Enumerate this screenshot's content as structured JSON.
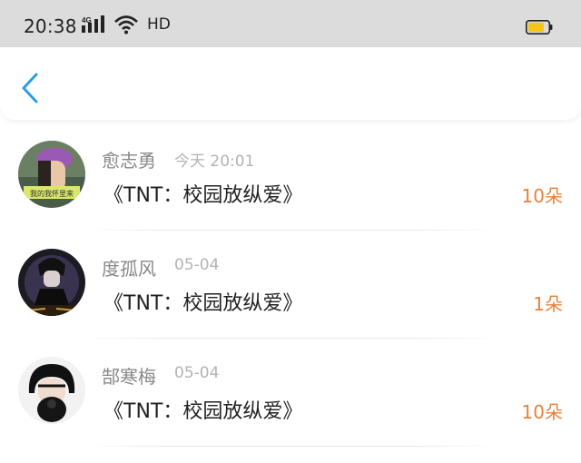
{
  "status_bar": {
    "time": "20:38",
    "network_label": "4G",
    "hd_label": "HD",
    "battery_color": "#f5c518"
  },
  "nav": {
    "back_icon": "chevron-left-icon",
    "accent": "#2b9de8"
  },
  "gifts": [
    {
      "name": "愈志勇",
      "time": "今天 20:01",
      "title": "《TNT：校园放纵爱》",
      "amount": "10朵",
      "avatar_text": "我的我怀里来"
    },
    {
      "name": "度孤风",
      "time": "05-04",
      "title": "《TNT：校园放纵爱》",
      "amount": "1朵",
      "avatar_text": ""
    },
    {
      "name": "郜寒梅",
      "time": "05-04",
      "title": "《TNT：校园放纵爱》",
      "amount": "10朵",
      "avatar_text": ""
    }
  ],
  "colors": {
    "amount": "#e8823b",
    "name": "#888888",
    "time": "#b3b3b3"
  }
}
